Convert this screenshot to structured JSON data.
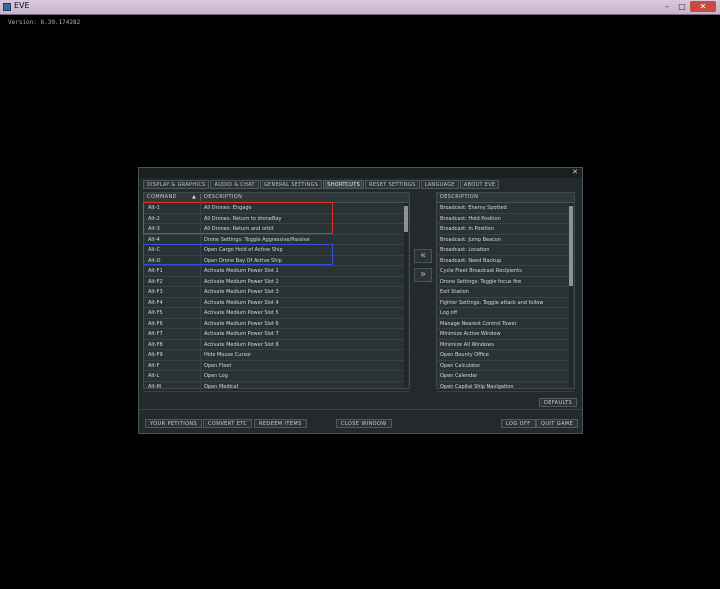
{
  "window": {
    "title": "EVE",
    "minimize": "–",
    "maximize": "□",
    "close": "✕"
  },
  "version_text": "Version: 6.30.174282",
  "settings": {
    "close_label": "✕",
    "tabs": [
      {
        "label": "DISPLAY & GRAPHICS",
        "active": false
      },
      {
        "label": "AUDIO & CHAT",
        "active": false
      },
      {
        "label": "GENERAL SETTINGS",
        "active": false
      },
      {
        "label": "SHORTCUTS",
        "active": true
      },
      {
        "label": "RESET SETTINGS",
        "active": false
      },
      {
        "label": "LANGUAGE",
        "active": false
      },
      {
        "label": "ABOUT EVE",
        "active": false
      }
    ],
    "left_table": {
      "headers": {
        "command": "COMMAND",
        "description": "DESCRIPTION"
      },
      "rows": [
        {
          "command": "Alt-1",
          "description": "All Drones: Engage"
        },
        {
          "command": "Alt-2",
          "description": "All Drones: Return to droneBay"
        },
        {
          "command": "Alt-3",
          "description": "All Drones: Return and orbit"
        },
        {
          "command": "Alt-4",
          "description": "Drone Settings: Toggle Aggressive/Passive"
        },
        {
          "command": "Alt-C",
          "description": "Open Cargo Hold of Active Ship"
        },
        {
          "command": "Alt-D",
          "description": "Open Drone Bay Of Active Ship"
        },
        {
          "command": "Alt-F1",
          "description": "Activate Medium Power Slot 1"
        },
        {
          "command": "Alt-F2",
          "description": "Activate Medium Power Slot 2"
        },
        {
          "command": "Alt-F3",
          "description": "Activate Medium Power Slot 3"
        },
        {
          "command": "Alt-F4",
          "description": "Activate Medium Power Slot 4"
        },
        {
          "command": "Alt-F5",
          "description": "Activate Medium Power Slot 5"
        },
        {
          "command": "Alt-F6",
          "description": "Activate Medium Power Slot 6"
        },
        {
          "command": "Alt-F7",
          "description": "Activate Medium Power Slot 7"
        },
        {
          "command": "Alt-F8",
          "description": "Activate Medium Power Slot 8"
        },
        {
          "command": "Alt-F9",
          "description": "Hide Mouse Cursor"
        },
        {
          "command": "Alt-F",
          "description": "Open Fleet"
        },
        {
          "command": "Alt-L",
          "description": "Open Log"
        },
        {
          "command": "Alt-M",
          "description": "Open Medical"
        }
      ]
    },
    "right_table": {
      "header": "DESCRIPTION",
      "rows": [
        "Broadcast: Enemy Spotted",
        "Broadcast: Hold Position",
        "Broadcast: In Position",
        "Broadcast: Jump Beacon",
        "Broadcast: Location",
        "Broadcast: Need Backup",
        "Cycle Fleet Broadcast Recipients",
        "Drone Settings: Toggle focus fire",
        "Exit Station",
        "Fighter Settings: Toggle attack and follow",
        "Log off",
        "Manage Nearest Control Tower",
        "Minimize Active Window",
        "Minimize All Windows",
        "Open Bounty Office",
        "Open Calculator",
        "Open Calendar",
        "Open Capital Ship Navigation"
      ]
    },
    "arrow_left": "«",
    "arrow_right": "»",
    "defaults_button": "DEFAULTS",
    "footer": {
      "your_petitions": "YOUR PETITIONS",
      "convert_etc": "CONVERT ETC",
      "redeem_items": "REDEEM ITEMS",
      "close_window": "CLOSE WINDOW",
      "log_off": "LOG OFF",
      "quit_game": "QUIT GAME"
    }
  },
  "highlight_colors": {
    "red_box": "#e0302a",
    "blue_box": "#3550d8"
  }
}
